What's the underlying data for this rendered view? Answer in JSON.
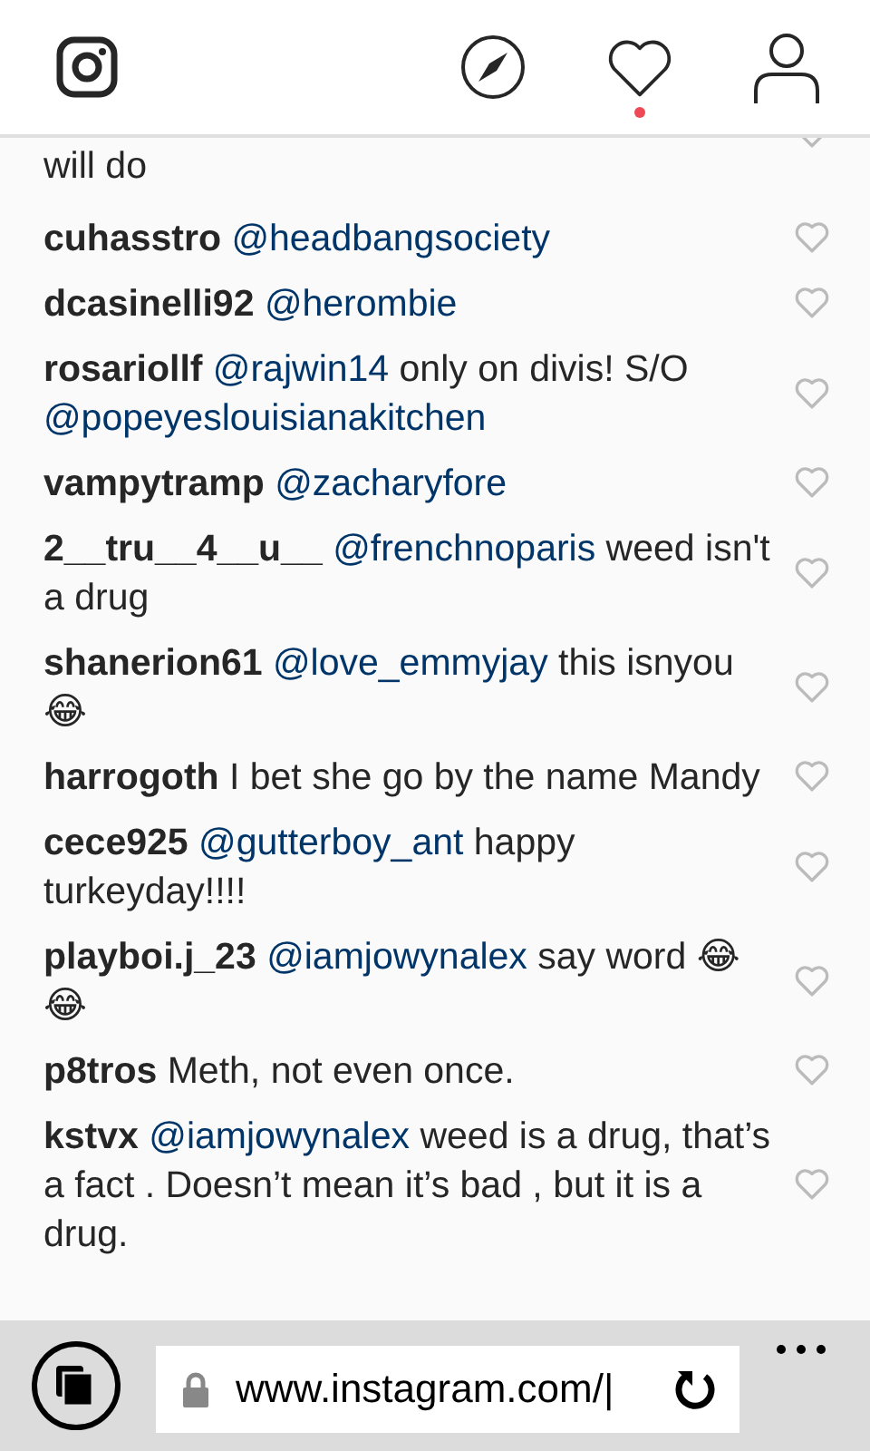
{
  "top_bar": {
    "notification_dot": true
  },
  "partial_comment": {
    "text": "will do"
  },
  "comments": [
    {
      "user": "cuhasstro",
      "mention": "@headbangsociety"
    },
    {
      "user": "dcasinelli92",
      "mention": "@herombie"
    },
    {
      "user": "rosariollf",
      "mention": "@rajwin14",
      "text": "only on divis! S/O",
      "mention_2": "@popeyeslouisianakitchen"
    },
    {
      "user": "vampytramp",
      "mention": "@zacharyfore"
    },
    {
      "user": "2__tru__4__u__",
      "mention": "@frenchnoparis",
      "text": "weed isn't a drug"
    },
    {
      "user": "shanerion61",
      "mention": "@love_emmyjay",
      "text": "this isnyou 😂"
    },
    {
      "user": "harrogoth",
      "text": "I bet she go by the name Mandy"
    },
    {
      "user": "cece925",
      "mention": "@gutterboy_ant",
      "text": "happy turkeyday!!!!"
    },
    {
      "user": "playboi.j_23",
      "mention": "@iamjowynalex",
      "text": "say word 😂😂"
    },
    {
      "user": "p8tros",
      "text": "Meth, not even once."
    },
    {
      "user": "kstvx",
      "mention": "@iamjowynalex",
      "text": "weed is a drug, that’s a fact . Doesn’t mean it’s bad , but it is a drug."
    }
  ],
  "address_bar": {
    "url": "www.instagram.com/|"
  }
}
